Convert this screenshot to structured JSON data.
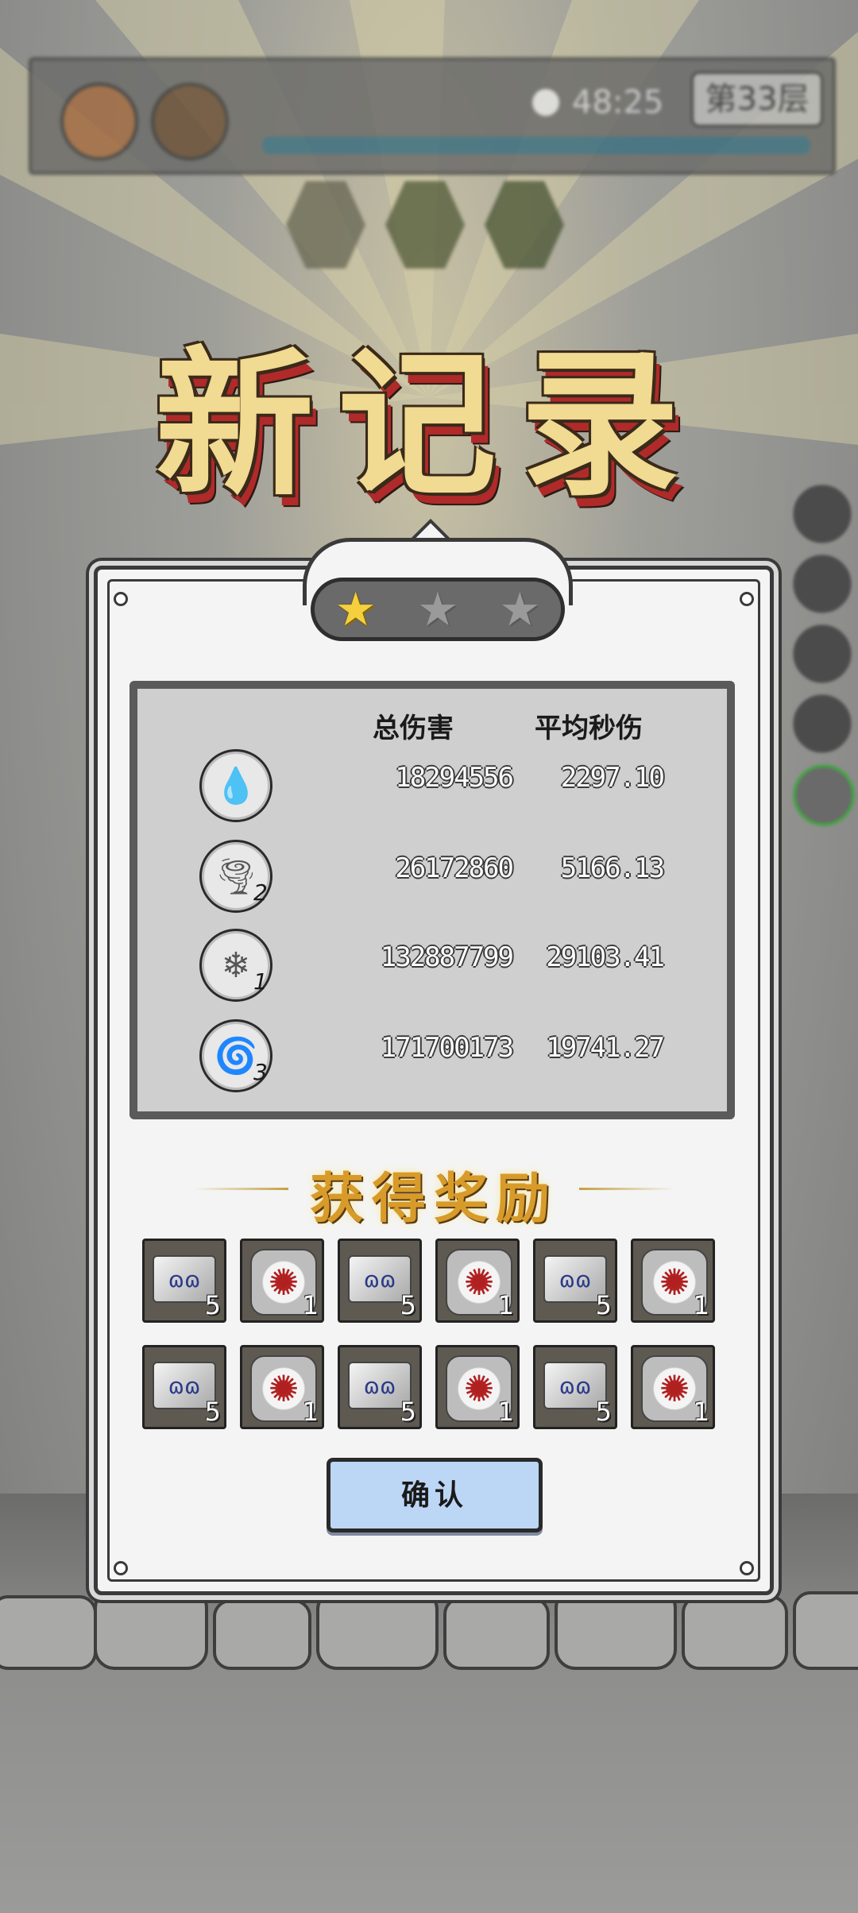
{
  "hud": {
    "timer": "48:25",
    "floor_label": "第33层",
    "left_icons": [
      "speed-toggle-icon",
      "backpack-icon"
    ],
    "skill_hexes": [
      "gear-skill-icon",
      "skull-skill-icon",
      "dagger-skill-icon"
    ]
  },
  "title": "新记录",
  "result": {
    "stars_earned": 1,
    "stars_total": 3,
    "headers": {
      "total_damage": "总伤害",
      "avg_dps": "平均秒伤"
    },
    "skills": [
      {
        "icon": "water-drop-icon",
        "level": "",
        "total_damage": "18294556",
        "avg_dps": "2297.10"
      },
      {
        "icon": "tornado-icon",
        "level": "2",
        "total_damage": "26172860",
        "avg_dps": "5166.13"
      },
      {
        "icon": "crystal-icon",
        "level": "1",
        "total_damage": "132887799",
        "avg_dps": "29103.41"
      },
      {
        "icon": "drill-icon",
        "level": "3",
        "total_damage": "171700173",
        "avg_dps": "19741.27"
      }
    ]
  },
  "rewards": {
    "title": "获得奖励",
    "items": [
      {
        "type": "bar",
        "icon": "ore-bar-icon",
        "count": "5"
      },
      {
        "type": "gem",
        "icon": "red-core-stone-icon",
        "count": "1"
      },
      {
        "type": "bar",
        "icon": "ore-bar-icon",
        "count": "5"
      },
      {
        "type": "gem",
        "icon": "red-core-stone-icon",
        "count": "1"
      },
      {
        "type": "bar",
        "icon": "ore-bar-icon",
        "count": "5"
      },
      {
        "type": "gem",
        "icon": "red-core-stone-icon",
        "count": "1"
      },
      {
        "type": "bar",
        "icon": "ore-bar-icon",
        "count": "5"
      },
      {
        "type": "gem",
        "icon": "red-core-stone-icon",
        "count": "1"
      },
      {
        "type": "bar",
        "icon": "ore-bar-icon",
        "count": "5"
      },
      {
        "type": "gem",
        "icon": "red-core-stone-icon",
        "count": "1"
      },
      {
        "type": "bar",
        "icon": "ore-bar-icon",
        "count": "5"
      },
      {
        "type": "gem",
        "icon": "red-core-stone-icon",
        "count": "1"
      }
    ]
  },
  "confirm_label": "确认",
  "colors": {
    "title_gold": "#f1da91",
    "reward_title": "#d89b2a",
    "confirm_bg": "#bcd7f5",
    "star_on": "#f4d03f"
  }
}
